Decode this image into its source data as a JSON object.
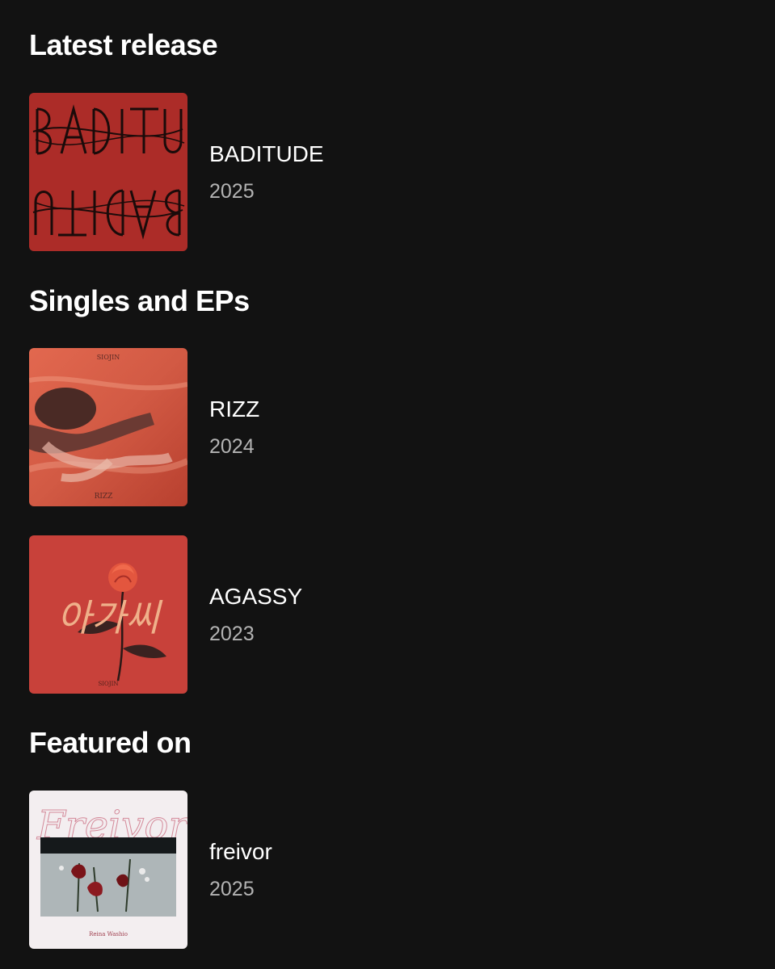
{
  "sections": [
    {
      "title": "Latest release",
      "items": [
        {
          "title": "BADITUDE",
          "year": "2025",
          "cover_icon": "baditude-album-cover",
          "accent": "#b7302d"
        }
      ]
    },
    {
      "title": "Singles and EPs",
      "items": [
        {
          "title": "RIZZ",
          "year": "2024",
          "cover_icon": "rizz-album-cover",
          "accent": "#d8604a"
        },
        {
          "title": "AGASSY",
          "year": "2023",
          "cover_icon": "agassy-album-cover",
          "accent": "#c8413a"
        }
      ]
    },
    {
      "title": "Featured on",
      "items": [
        {
          "title": "freivor",
          "year": "2025",
          "cover_icon": "freivor-album-cover",
          "accent": "#f3eef0"
        }
      ]
    }
  ],
  "colors": {
    "background": "#121212",
    "title_text": "#ffffff",
    "secondary_text": "#b3b3b3"
  }
}
